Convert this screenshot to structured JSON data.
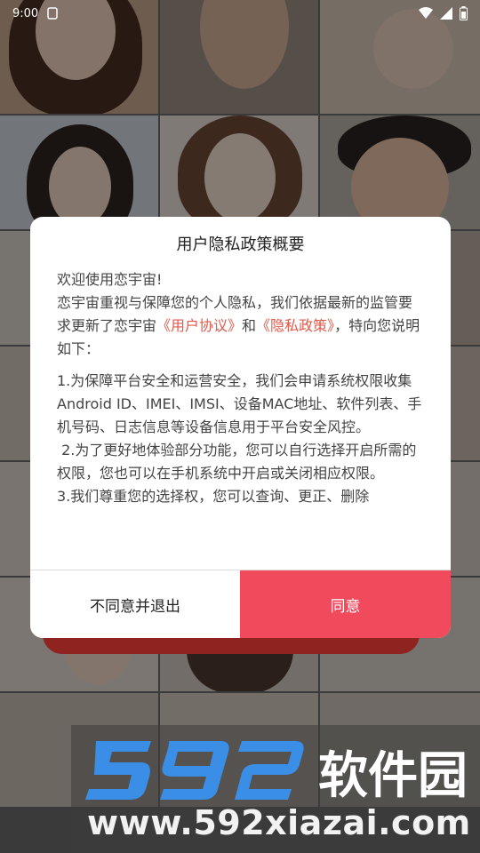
{
  "status_bar": {
    "time": "9:00"
  },
  "dialog": {
    "title": "用户隐私政策概要",
    "greeting": "欢迎使用恋宇宙!",
    "intro_before": "恋宇宙重视与保障您的个人隐私，我们依据最新的监管要求更新了恋宇宙",
    "link_user_agreement": "《用户协议》",
    "intro_and": "和",
    "link_privacy_policy": "《隐私政策》",
    "intro_after": "，特向您说明如下：",
    "item1": "1.为保障平台安全和运营安全，我们会申请系统权限收集Android ID、IMEI、IMSI、设备MAC地址、软件列表、手机号码、日志信息等设备信息用于平台安全风控。",
    "item2": " 2.为了更好地体验部分功能，您可以自行选择开启所需的权限，您也可以在手机系统中开启或关闭相应权限。",
    "item3": "3.我们尊重您的选择权，您可以查询、更正、删除",
    "decline_label": "不同意并退出",
    "agree_label": "同意"
  },
  "watermark": {
    "logo_text": "592软件园",
    "url": "www.592xiazai.com"
  },
  "colors": {
    "accent": "#f04a5c",
    "link": "#e2584a",
    "watermark_blue": "#3a8ee6"
  }
}
